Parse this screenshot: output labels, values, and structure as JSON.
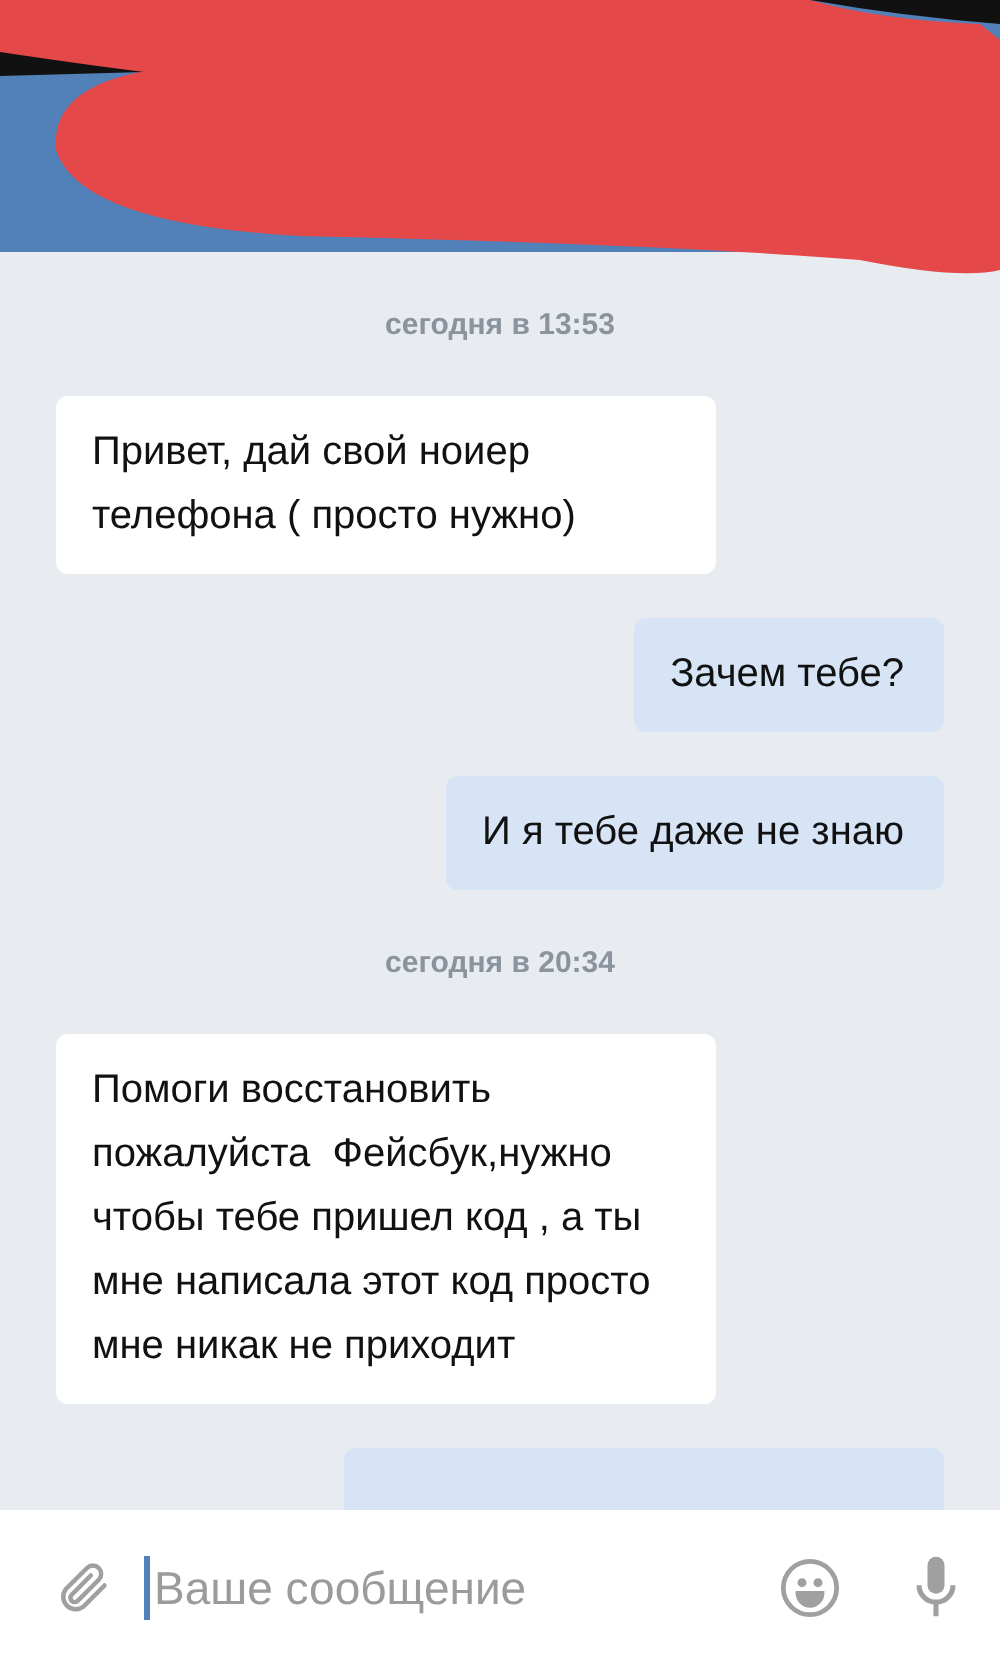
{
  "chat": [
    {
      "kind": "date",
      "text": "сегодня в 13:53"
    },
    {
      "kind": "message",
      "outgoing": false,
      "text": "Привет, дай свой ноиер телефона ( просто нужно)"
    },
    {
      "kind": "message",
      "outgoing": true,
      "text": "Зачем тебе?"
    },
    {
      "kind": "message",
      "outgoing": true,
      "text": "И я тебе даже не знаю"
    },
    {
      "kind": "date",
      "text": "сегодня в 20:34"
    },
    {
      "kind": "message",
      "outgoing": false,
      "text": "Помоги восстановить пожалуйста  Фейсбук,нужно чтобы тебе пришел код , а ты мне написала этот код просто мне никак не приходит"
    },
    {
      "kind": "message",
      "outgoing": true
    }
  ],
  "composer": {
    "placeholder": "Ваше сообщение"
  }
}
